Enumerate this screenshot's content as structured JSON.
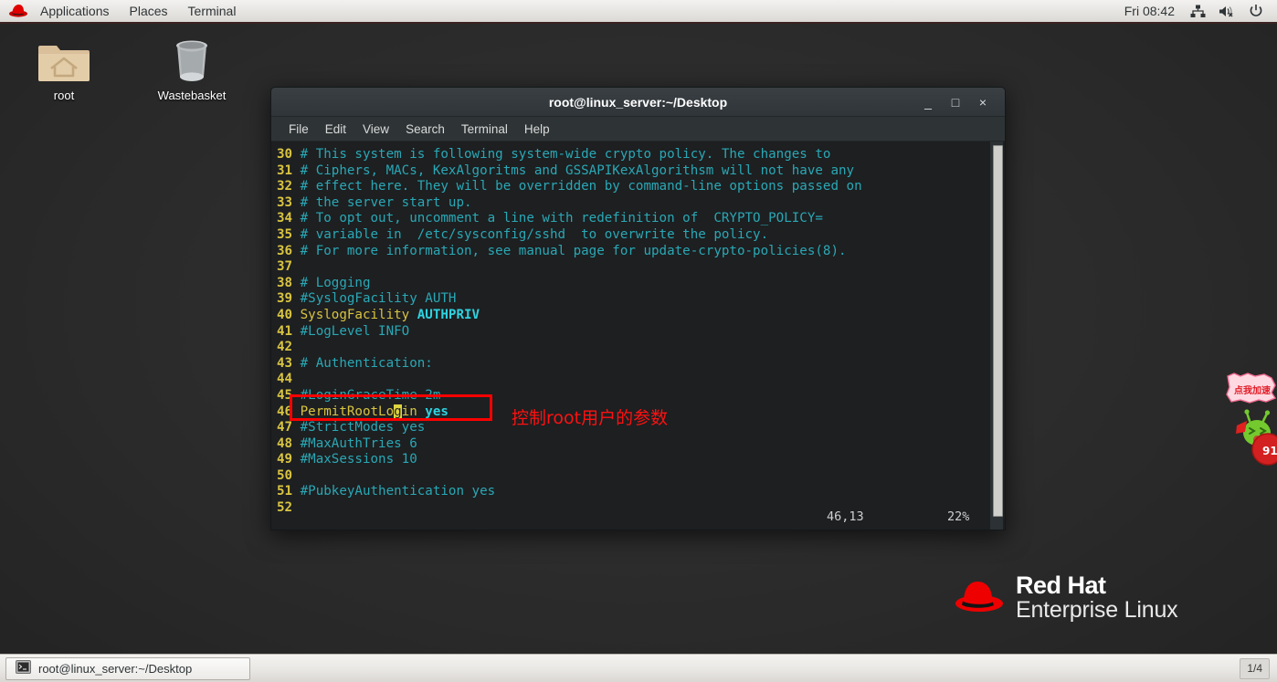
{
  "top_panel": {
    "logo_icon": "redhat-logo-icon",
    "menus": [
      "Applications",
      "Places",
      "Terminal"
    ],
    "clock": "Fri 08:42",
    "tray": [
      {
        "icon": "network-icon"
      },
      {
        "icon": "volume-muted-icon"
      },
      {
        "icon": "power-icon"
      }
    ]
  },
  "desktop": {
    "icons": [
      {
        "name": "home-folder-icon",
        "label": "root"
      },
      {
        "name": "wastebasket-icon",
        "label": "Wastebasket"
      }
    ],
    "watermark_brand_line1": "Red Hat",
    "watermark_brand_line2": "Enterprise Linux"
  },
  "terminal": {
    "title": "root@linux_server:~/Desktop",
    "window_controls": {
      "minimize": "_",
      "maximize": "□",
      "close": "×"
    },
    "menus": [
      "File",
      "Edit",
      "View",
      "Search",
      "Terminal",
      "Help"
    ],
    "lines": [
      {
        "num": "30",
        "segments": [
          {
            "t": "# This system is following system-wide crypto policy. The changes to",
            "c": "cmt"
          }
        ]
      },
      {
        "num": "31",
        "segments": [
          {
            "t": "# Ciphers, MACs, KexAlgoritms and GSSAPIKexAlgorithsm will not have any",
            "c": "cmt"
          }
        ]
      },
      {
        "num": "32",
        "segments": [
          {
            "t": "# effect here. They will be overridden by command-line options passed on",
            "c": "cmt"
          }
        ]
      },
      {
        "num": "33",
        "segments": [
          {
            "t": "# the server start up.",
            "c": "cmt"
          }
        ]
      },
      {
        "num": "34",
        "segments": [
          {
            "t": "# To opt out, uncomment a line with redefinition of  CRYPTO_POLICY=",
            "c": "cmt"
          }
        ]
      },
      {
        "num": "35",
        "segments": [
          {
            "t": "# variable in  /etc/sysconfig/sshd  to overwrite the policy.",
            "c": "cmt"
          }
        ]
      },
      {
        "num": "36",
        "segments": [
          {
            "t": "# For more information, see manual page for update-crypto-policies(8).",
            "c": "cmt"
          }
        ]
      },
      {
        "num": "37",
        "segments": []
      },
      {
        "num": "38",
        "segments": [
          {
            "t": "# Logging",
            "c": "cmt"
          }
        ]
      },
      {
        "num": "39",
        "segments": [
          {
            "t": "#SyslogFacility AUTH",
            "c": "cmt"
          }
        ]
      },
      {
        "num": "40",
        "segments": [
          {
            "t": "SyslogFacility ",
            "c": "key"
          },
          {
            "t": "AUTHPRIV",
            "c": "val"
          }
        ]
      },
      {
        "num": "41",
        "segments": [
          {
            "t": "#LogLevel INFO",
            "c": "cmt"
          }
        ]
      },
      {
        "num": "42",
        "segments": []
      },
      {
        "num": "43",
        "segments": [
          {
            "t": "# Authentication:",
            "c": "cmt"
          }
        ]
      },
      {
        "num": "44",
        "segments": []
      },
      {
        "num": "45",
        "segments": [
          {
            "t": "#LoginGraceTime 2m",
            "c": "cmt"
          }
        ]
      },
      {
        "num": "46",
        "segments": [
          {
            "t": "PermitRootLo",
            "c": "key"
          },
          {
            "t": "g",
            "c": "cursor"
          },
          {
            "t": "in ",
            "c": "key"
          },
          {
            "t": "yes",
            "c": "val"
          }
        ]
      },
      {
        "num": "47",
        "segments": [
          {
            "t": "#StrictModes yes",
            "c": "cmt"
          }
        ]
      },
      {
        "num": "48",
        "segments": [
          {
            "t": "#MaxAuthTries 6",
            "c": "cmt"
          }
        ]
      },
      {
        "num": "49",
        "segments": [
          {
            "t": "#MaxSessions 10",
            "c": "cmt"
          }
        ]
      },
      {
        "num": "50",
        "segments": []
      },
      {
        "num": "51",
        "segments": [
          {
            "t": "#PubkeyAuthentication yes",
            "c": "cmt"
          }
        ]
      },
      {
        "num": "52",
        "segments": []
      }
    ],
    "status_position": "46,13",
    "status_percent": "22%"
  },
  "annotation": {
    "text": "控制root用户的参数",
    "color": "#ff0000"
  },
  "ad_widget": {
    "bubble_text": "点我加速",
    "badge_text": "91"
  },
  "taskbar": {
    "task_icon": "terminal-icon",
    "task_label": "root@linux_server:~/Desktop",
    "workspace": "1/4"
  },
  "watermark": {
    "url": "https://blog.csdn.net/weixin_4929..."
  },
  "colors": {
    "accent_red": "#ee0000",
    "terminal_bg": "#1d1f21",
    "comment": "#2aa8b5",
    "line_number": "#d9c441",
    "cursor": "#ddd43f"
  }
}
